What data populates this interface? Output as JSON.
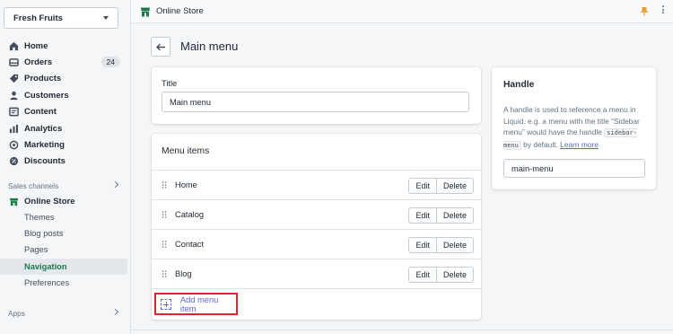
{
  "sidebar": {
    "store_name": "Fresh Fruits",
    "items": [
      {
        "label": "Home",
        "icon": "home-icon"
      },
      {
        "label": "Orders",
        "icon": "orders-icon",
        "badge": "24"
      },
      {
        "label": "Products",
        "icon": "products-icon"
      },
      {
        "label": "Customers",
        "icon": "customers-icon"
      },
      {
        "label": "Content",
        "icon": "content-icon"
      },
      {
        "label": "Analytics",
        "icon": "analytics-icon"
      },
      {
        "label": "Marketing",
        "icon": "marketing-icon"
      },
      {
        "label": "Discounts",
        "icon": "discounts-icon"
      }
    ],
    "sales_channels_label": "Sales channels",
    "online_store": "Online Store",
    "sub_items": [
      "Themes",
      "Blog posts",
      "Pages",
      "Navigation",
      "Preferences"
    ],
    "active_sub_item": "Navigation",
    "apps_label": "Apps"
  },
  "topbar": {
    "title": "Online Store"
  },
  "page": {
    "title": "Main menu"
  },
  "title_card": {
    "label": "Title",
    "value": "Main menu"
  },
  "menu_items": {
    "heading": "Menu items",
    "rows": [
      {
        "label": "Home"
      },
      {
        "label": "Catalog"
      },
      {
        "label": "Contact"
      },
      {
        "label": "Blog"
      }
    ],
    "edit_label": "Edit",
    "delete_label": "Delete",
    "add_label": "Add menu item"
  },
  "handle_card": {
    "title": "Handle",
    "help_1": "A handle is used to reference a menu in Liquid. e.g. a menu with the title “Sidebar menu” would have the handle ",
    "help_code": "sidebar-menu",
    "help_2": " by default. ",
    "help_link": "Learn more",
    "value": "main-menu"
  },
  "colors": {
    "accent": "#5c6ac4",
    "brand_green": "#1e7a4a",
    "highlight": "#e0262c"
  }
}
